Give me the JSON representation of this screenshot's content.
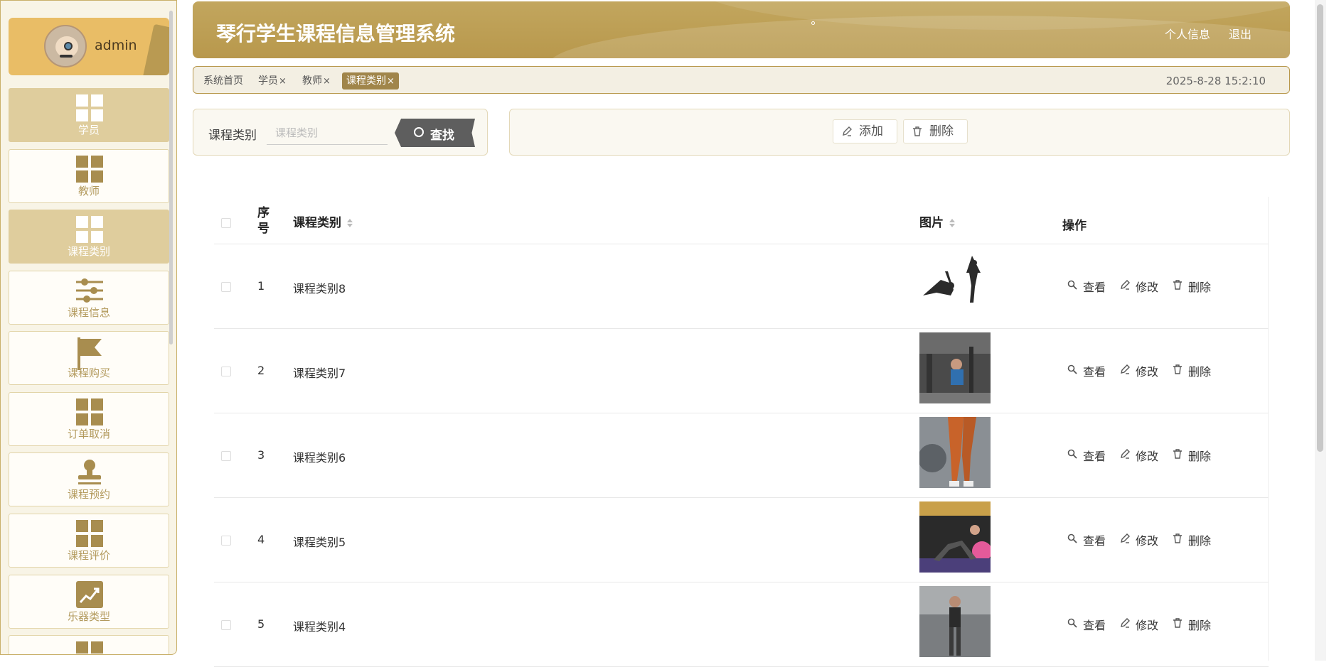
{
  "app": {
    "title": "琴行学生课程信息管理系统",
    "user": "admin",
    "header_links": [
      "个人信息",
      "退出"
    ]
  },
  "sidebar": {
    "items": [
      {
        "label": "学员",
        "icon": "grid-icon",
        "active": true
      },
      {
        "label": "教师",
        "icon": "grid-icon",
        "active": false
      },
      {
        "label": "课程类别",
        "icon": "grid-icon",
        "active": true
      },
      {
        "label": "课程信息",
        "icon": "sliders-icon",
        "active": false
      },
      {
        "label": "课程购买",
        "icon": "flag-icon",
        "active": false
      },
      {
        "label": "订单取消",
        "icon": "grid-icon",
        "active": false
      },
      {
        "label": "课程预约",
        "icon": "stamp-icon",
        "active": false
      },
      {
        "label": "课程评价",
        "icon": "grid-icon",
        "active": false
      },
      {
        "label": "乐器类型",
        "icon": "trend-chart-icon",
        "active": false
      }
    ]
  },
  "tabs": [
    {
      "label": "系统首页",
      "closable": false,
      "active": false
    },
    {
      "label": "学员",
      "closable": true,
      "active": false
    },
    {
      "label": "教师",
      "closable": true,
      "active": false
    },
    {
      "label": "课程类别",
      "closable": true,
      "active": true
    }
  ],
  "tab_close_glyph": "×",
  "datetime": "2025-8-28 15:2:10",
  "search": {
    "label": "课程类别",
    "placeholder": "课程类别",
    "value": "",
    "button": "查找"
  },
  "actions": {
    "add": "添加",
    "delete": "删除"
  },
  "table": {
    "headers": {
      "index": "序号",
      "name": "课程类别",
      "image": "图片",
      "ops": "操作"
    },
    "op_labels": {
      "view": "查看",
      "edit": "修改",
      "delete": "删除"
    },
    "rows": [
      {
        "index": "1",
        "name": "课程类别8",
        "image": "yoga-silhouette-image"
      },
      {
        "index": "2",
        "name": "课程类别7",
        "image": "gym-photo-image"
      },
      {
        "index": "3",
        "name": "课程类别6",
        "image": "leggings-photo-image"
      },
      {
        "index": "4",
        "name": "课程类别5",
        "image": "stretching-photo-image"
      },
      {
        "index": "5",
        "name": "课程类别4",
        "image": "workout-photo-image"
      }
    ]
  },
  "colors": {
    "accent": "#b8984c",
    "sidebar_active": "#dfcd9d",
    "tab_active": "#a0854a",
    "search_button": "#5e5e5e"
  }
}
